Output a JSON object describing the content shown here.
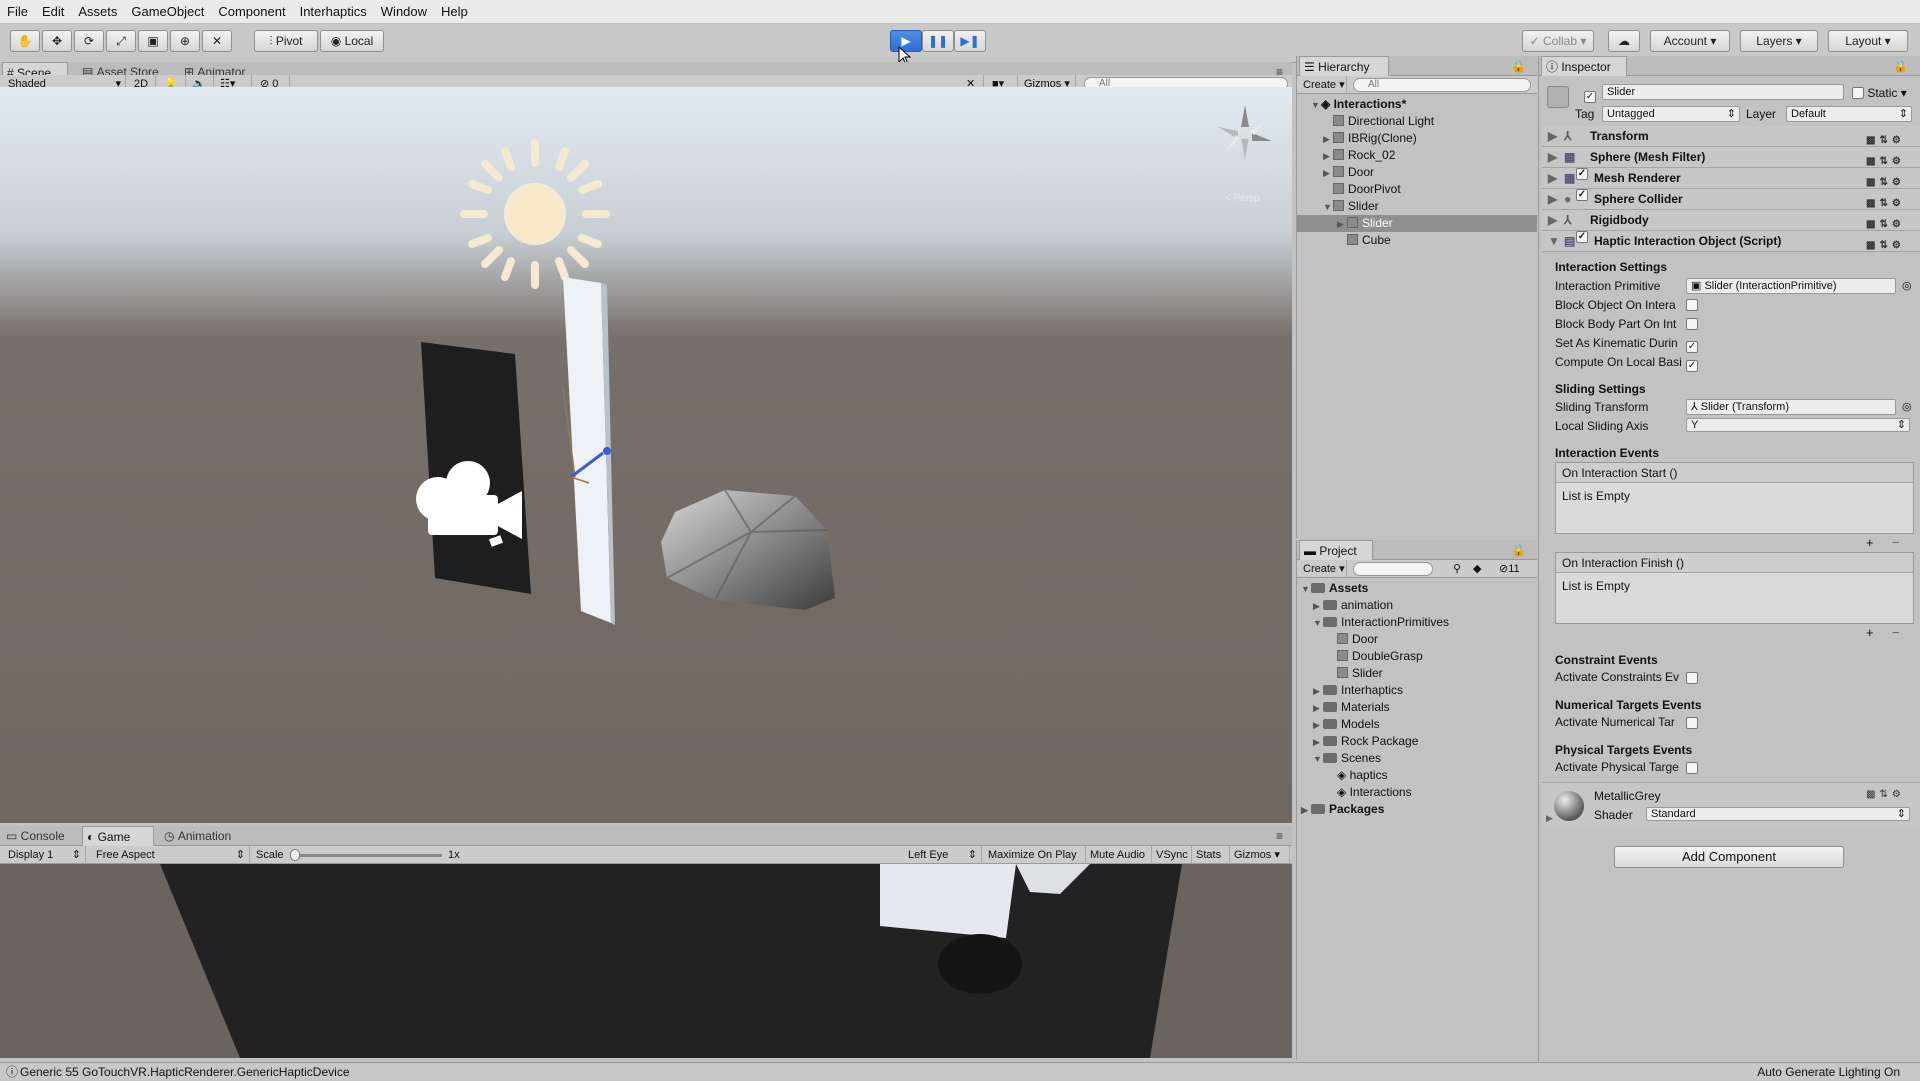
{
  "menu": [
    "File",
    "Edit",
    "Assets",
    "GameObject",
    "Component",
    "Interhaptics",
    "Window",
    "Help"
  ],
  "toolbar": {
    "pivot": "Pivot",
    "local": "Local",
    "collab": "Collab",
    "account": "Account",
    "layers": "Layers",
    "layout": "Layout"
  },
  "scene": {
    "tabs": [
      "Scene",
      "Asset Store",
      "Animator"
    ],
    "shading": "Shaded",
    "mode2d": "2D",
    "hidden_count": "0",
    "gizmos": "Gizmos",
    "search_placeholder": "All",
    "persp_label": "< Persp"
  },
  "game": {
    "tabs": [
      "Console",
      "Game",
      "Animation"
    ],
    "display": "Display 1",
    "aspect": "Free Aspect",
    "scale_label": "Scale",
    "scale_value": "1x",
    "scale_fraction": 0.0,
    "eye": "Left Eye",
    "options": [
      "Maximize On Play",
      "Mute Audio",
      "VSync",
      "Stats",
      "Gizmos"
    ]
  },
  "hierarchy": {
    "title": "Hierarchy",
    "create": "Create",
    "search_placeholder": "All",
    "scene": "Interactions*",
    "items": [
      {
        "label": "Directional Light"
      },
      {
        "label": "IBRig(Clone)"
      },
      {
        "label": "Rock_02"
      },
      {
        "label": "Door"
      },
      {
        "label": "DoorPivot"
      },
      {
        "label": "Slider"
      },
      {
        "label": "Slider"
      },
      {
        "label": "Cube"
      }
    ]
  },
  "project": {
    "title": "Project",
    "create": "Create",
    "count": "11",
    "root": "Assets",
    "items": [
      {
        "label": "animation"
      },
      {
        "label": "InteractionPrimitives"
      },
      {
        "label": "Door"
      },
      {
        "label": "DoubleGrasp"
      },
      {
        "label": "Slider"
      },
      {
        "label": "Interhaptics"
      },
      {
        "label": "Materials"
      },
      {
        "label": "Models"
      },
      {
        "label": "Rock Package"
      },
      {
        "label": "Scenes"
      },
      {
        "label": "haptics"
      },
      {
        "label": "Interactions"
      },
      {
        "label": "Packages"
      }
    ]
  },
  "inspector": {
    "title": "Inspector",
    "name": "Slider",
    "static": "Static",
    "tag_label": "Tag",
    "tag_value": "Untagged",
    "layer_label": "Layer",
    "layer_value": "Default",
    "components": [
      "Transform",
      "Sphere (Mesh Filter)",
      "Mesh Renderer",
      "Sphere Collider",
      "Rigidbody",
      "Haptic Interaction Object (Script)"
    ],
    "interaction_settings": {
      "title": "Interaction Settings",
      "primitive_label": "Interaction Primitive",
      "primitive_value": "Slider (InteractionPrimitive)",
      "block_object": "Block Object On Intera",
      "block_body": "Block Body Part On Int",
      "kinematic": "Set As Kinematic Durin",
      "compute": "Compute On Local Basi"
    },
    "sliding_settings": {
      "title": "Sliding Settings",
      "transform_label": "Sliding Transform",
      "transform_value": "Slider (Transform)",
      "axis_label": "Local Sliding Axis",
      "axis_value": "Y"
    },
    "events": {
      "title": "Interaction Events",
      "start": "On Interaction Start ()",
      "finish": "On Interaction Finish ()",
      "empty": "List is Empty"
    },
    "constraint": {
      "title": "Constraint Events",
      "field": "Activate Constraints Ev"
    },
    "numerical": {
      "title": "Numerical Targets Events",
      "field": "Activate Numerical Tar"
    },
    "physical": {
      "title": "Physical Targets Events",
      "field": "Activate Physical Targe"
    },
    "material": {
      "name": "MetallicGrey",
      "shader_label": "Shader",
      "shader_value": "Standard"
    },
    "add_component": "Add Component"
  },
  "status": {
    "message": "Generic 55 GoTouchVR.HapticRenderer.GenericHapticDevice",
    "right": "Auto Generate Lighting On"
  }
}
